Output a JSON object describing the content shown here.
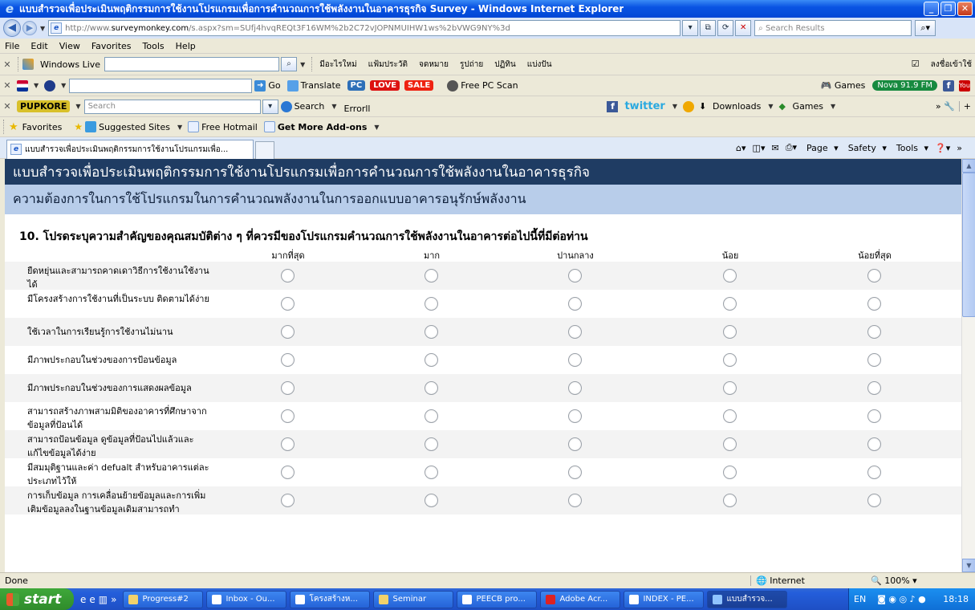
{
  "window": {
    "title": "แบบสำรวจเพื่อประเมินพฤติกรรมการใช้งานโปรแกรมเพื่อการคำนวณการใช้พลังงานในอาคารธุรกิจ Survey - Windows Internet Explorer"
  },
  "address": {
    "url_prefix": "http://www.",
    "url_domain": "surveymonkey.com",
    "url_rest": "/s.aspx?sm=SUfj4hvqREQt3F16WM%2b2C72vJOPNMUIHW1ws%2bVWG9NY%3d",
    "search_placeholder": "Search Results"
  },
  "menu": [
    "File",
    "Edit",
    "View",
    "Favorites",
    "Tools",
    "Help"
  ],
  "toolbar1": {
    "windows_live": "Windows Live",
    "links": [
      "มีอะไรใหม่",
      "แฟ้มประวัติ",
      "จดหมาย",
      "รูปถ่าย",
      "ปฏิทิน",
      "แบ่งปัน"
    ],
    "signin": "ลงชื่อเข้าใช้"
  },
  "toolbar2": {
    "go": "Go",
    "translate": "Translate",
    "pc": "PC",
    "love": "LOVE",
    "sale": "SALE",
    "free_scan": "Free PC Scan",
    "games": "Games",
    "radio": "Nova 91.9 FM"
  },
  "toolbar3": {
    "logo": "PUPKORE",
    "search_placeholder": "Search",
    "search_btn": "Search",
    "error": "Errorll",
    "twitter": "twitter",
    "downloads": "Downloads",
    "games": "Games"
  },
  "favbar": {
    "favorites": "Favorites",
    "suggested": "Suggested Sites",
    "hotmail": "Free Hotmail",
    "addons": "Get More Add-ons"
  },
  "tab": {
    "label": "แบบสำรวจเพื่อประเมินพฤติกรรมการใช้งานโปรแกรมเพื่อ..."
  },
  "commands": [
    "Page",
    "Safety",
    "Tools"
  ],
  "survey": {
    "title": "แบบสำรวจเพื่อประเมินพฤติกรรมการใช้งานโปรแกรมเพื่อการคำนวณการใช้พลังงานในอาคารธุรกิจ",
    "section": "ความต้องการในการใช้โปรแกรมในการคำนวณพลังงานในการออกแบบอาคารอนุรักษ์พลังงาน",
    "question": "10. โปรดระบุความสำคัญของคุณสมบัติต่าง ๆ ที่ควรมีของโปรแกรมคำนวณการใช้พลังงานในอาคารต่อไปนี้ที่มีต่อท่าน",
    "columns": [
      "มากที่สุด",
      "มาก",
      "ปานกลาง",
      "น้อย",
      "น้อยที่สุด"
    ],
    "rows": [
      "ยืดหยุ่นและสามารถคาดเดาวิธีการใช้งานใช้งานได้",
      "มีโครงสร้างการใช้งานที่เป็นระบบ ติดตามได้ง่าย",
      "ใช้เวลาในการเรียนรู้การใช้งานไม่นาน",
      "มีภาพประกอบในช่วงของการป้อนข้อมูล",
      "มีภาพประกอบในช่วงของการแสดงผลข้อมูล",
      "สามารถสร้างภาพสามมิติของอาคารที่ศึกษาจากข้อมูลที่ป้อนได้",
      "สามารถป้อนข้อมูล ดูข้อมูลที่ป้อนไปแล้วและแก้ไขข้อมูลได้ง่าย",
      "มีสมมุติฐานและค่า defualt สำหรับอาคารแต่ละประเภทไว้ให้",
      "การเก็บข้อมูล การเคลื่อนย้ายข้อมูลและการเพิ่มเติมข้อมูลลงในฐานข้อมูลเดิมสามารถทำ"
    ]
  },
  "status": {
    "text": "Done",
    "zone": "Internet",
    "zoom": "100%"
  },
  "taskbar": {
    "start": "start",
    "tasks": [
      "Progress#2",
      "Inbox - Ou...",
      "โครงสร้างห...",
      "Seminar",
      "PEECB pro...",
      "Adobe Acr...",
      "INDEX - PE...",
      "แบบสำรวจ..."
    ],
    "lang": "EN",
    "clock": "18:18"
  }
}
